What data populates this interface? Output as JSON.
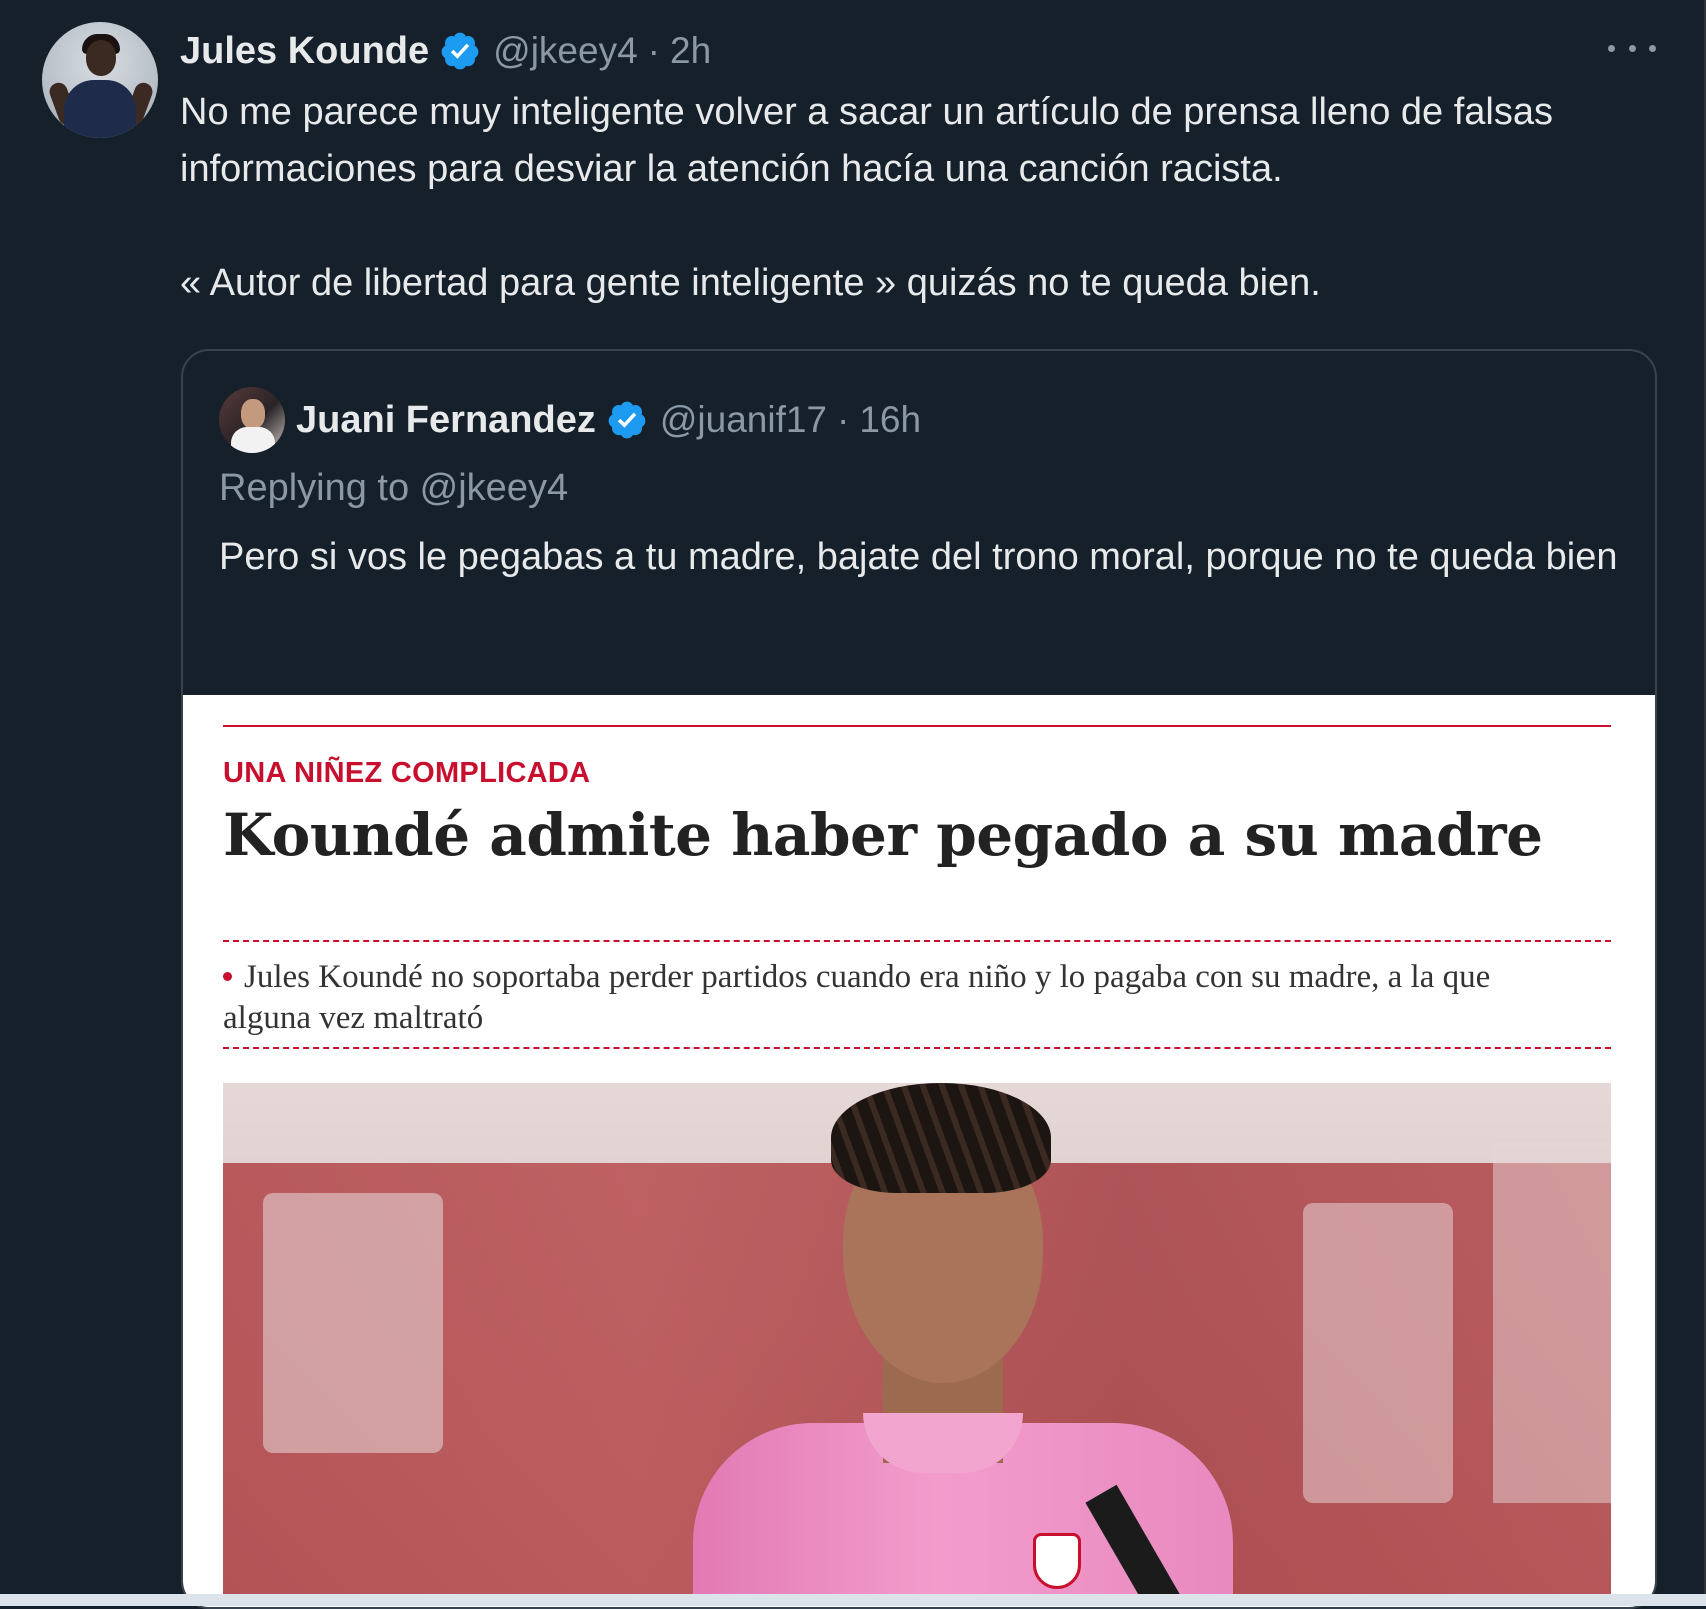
{
  "tweet": {
    "author_name": "Jules Kounde",
    "handle": "@jkeey4",
    "separator": "·",
    "time": "2h",
    "verified_icon": "verified-badge-icon",
    "more_icon": "more-options-icon",
    "text_line_1": "No me parece muy inteligente volver a sacar un artículo de prensa lleno de falsas informaciones para desviar la atención hacía una canción racista.",
    "text_line_2": "« Autor de libertad para gente inteligente » quizás no te queda bien."
  },
  "quote": {
    "author_name": "Juani Fernandez",
    "handle": "@juanif17",
    "separator": "·",
    "time": "16h",
    "replying_to": "Replying to @jkeey4",
    "text": "Pero si vos le pegabas a tu madre, bajate del trono moral, porque no te queda bien"
  },
  "article": {
    "kicker": "UNA NIÑEZ COMPLICADA",
    "headline": "Koundé admite haber pegado a su madre",
    "summary": "Jules Koundé no soportaba perder partidos cuando era niño y lo pagaba con su madre, a la que alguna vez maltrató"
  },
  "colors": {
    "background": "#15202b",
    "text": "#e7e9ea",
    "secondary_text": "#8b98a5",
    "verified": "#1d9bf0",
    "accent_red": "#c8102e"
  }
}
